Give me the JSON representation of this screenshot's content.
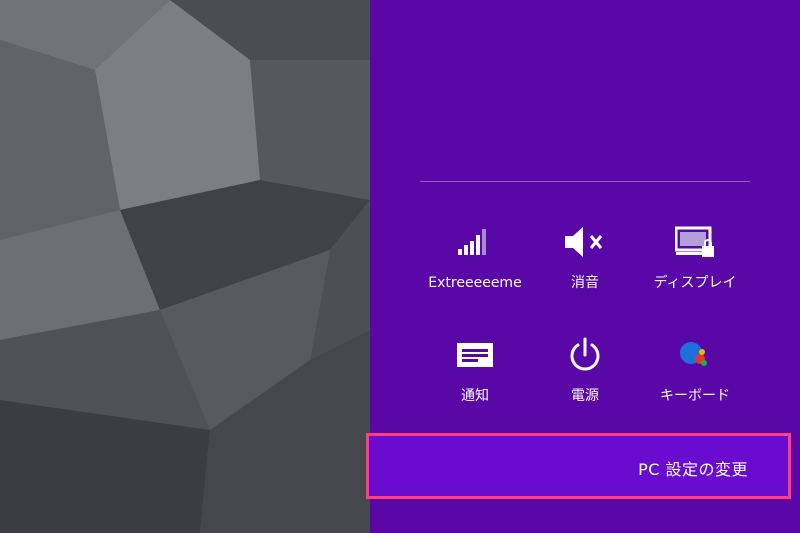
{
  "colors": {
    "pane_background": "#5a07a7",
    "pc_settings_background": "#6a0ccf",
    "highlight_border": "#ff3d7f",
    "text": "#ffffff"
  },
  "quick_settings": [
    {
      "label": "Extreeeeeme",
      "icon": "wifi-signal-icon"
    },
    {
      "label": "消音",
      "icon": "volume-muted-icon"
    },
    {
      "label": "ディスプレイ",
      "icon": "display-brightness-icon"
    },
    {
      "label": "通知",
      "icon": "notifications-icon"
    },
    {
      "label": "電源",
      "icon": "power-icon"
    },
    {
      "label": "キーボード",
      "icon": "keyboard-language-icon"
    }
  ],
  "pc_settings": {
    "label": "PC 設定の変更"
  }
}
